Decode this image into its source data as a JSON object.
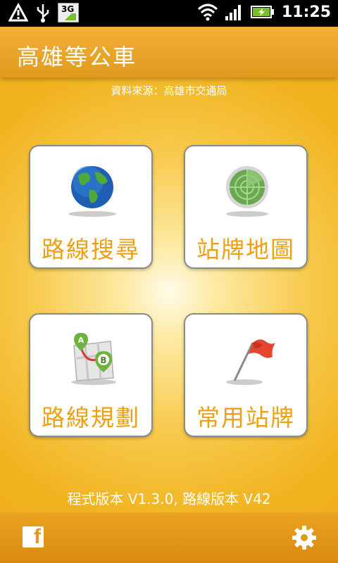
{
  "status_bar": {
    "network_type": "3G",
    "time": "11:25"
  },
  "header": {
    "title": "高雄等公車"
  },
  "source_note": "資料來源：高雄市交通局",
  "tiles": [
    {
      "label": "路線搜尋",
      "icon": "globe-icon"
    },
    {
      "label": "站牌地圖",
      "icon": "radar-icon"
    },
    {
      "label": "路線規劃",
      "icon": "route-map-icon"
    },
    {
      "label": "常用站牌",
      "icon": "flag-icon"
    }
  ],
  "version_text": "程式版本 V1.3.0, 路線版本 V42",
  "bottom_bar": {
    "left_icon": "facebook-icon",
    "right_icon": "gear-icon"
  },
  "colors": {
    "header": "#e8a421",
    "tile_label": "#ee9f12",
    "background": "#f1b320"
  }
}
